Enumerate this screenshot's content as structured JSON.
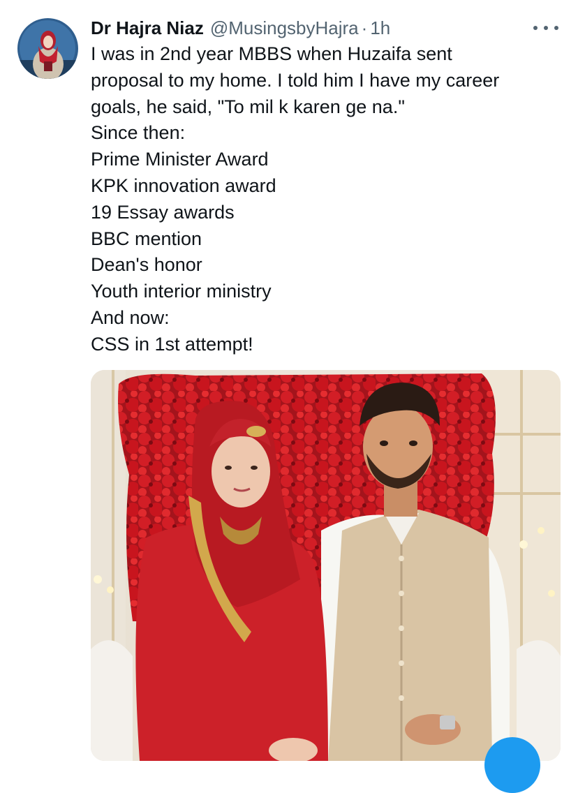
{
  "author": {
    "display_name": "Dr Hajra Niaz",
    "handle": "@MusingsbyHajra",
    "separator": "·",
    "time": "1h"
  },
  "tweet": {
    "lines": [
      "I was in 2nd year MBBS when Huzaifa sent",
      "proposal to my home. I told him I have my career",
      "goals, he said, \"To mil k karen ge na.\"",
      "Since then:",
      "Prime Minister Award",
      "KPK innovation award",
      "19 Essay awards",
      "BBC mention",
      "Dean's honor",
      "Youth interior ministry",
      "And now:",
      "CSS in 1st attempt!"
    ]
  },
  "colors": {
    "text_primary": "#0f1419",
    "text_secondary": "#536471",
    "accent": "#1d9bf0",
    "background": "#ffffff"
  },
  "icons": {
    "more": "more-horizontal-icon"
  }
}
